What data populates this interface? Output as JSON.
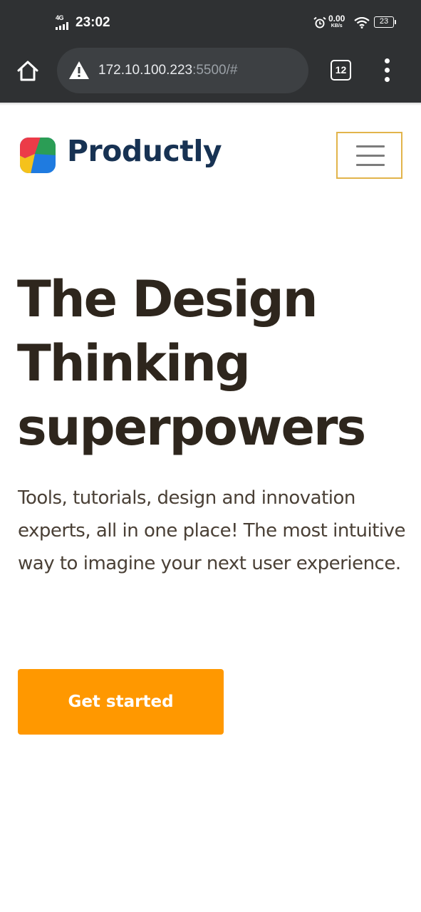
{
  "status_bar": {
    "network": "4G",
    "time": "23:02",
    "net_speed": "0.00",
    "net_speed_unit": "KB/s",
    "battery": "23",
    "icons": [
      "signal-icon",
      "alarm-icon",
      "wifi-icon",
      "battery-icon"
    ]
  },
  "browser": {
    "url_host": "172.10.100.223",
    "url_rest": ":5500/#",
    "tab_count": "12",
    "icons": [
      "home-icon",
      "insecure-warning-icon",
      "tabs-icon",
      "more-menu-icon"
    ]
  },
  "site": {
    "brand": "Productly",
    "logo_colors": [
      "#ec3b48",
      "#2b9d55",
      "#f5c21b",
      "#1f7be0"
    ],
    "hero_title": "The Design Thinking superpowers",
    "hero_text": "Tools, tutorials, design and innovation experts, all in one place! The most intuitive way to imagine your next user experience.",
    "cta_label": "Get started",
    "colors": {
      "brand_text": "#173253",
      "cta": "#ff9800",
      "menu_border": "#e2b44b",
      "title": "#2e261d"
    }
  }
}
